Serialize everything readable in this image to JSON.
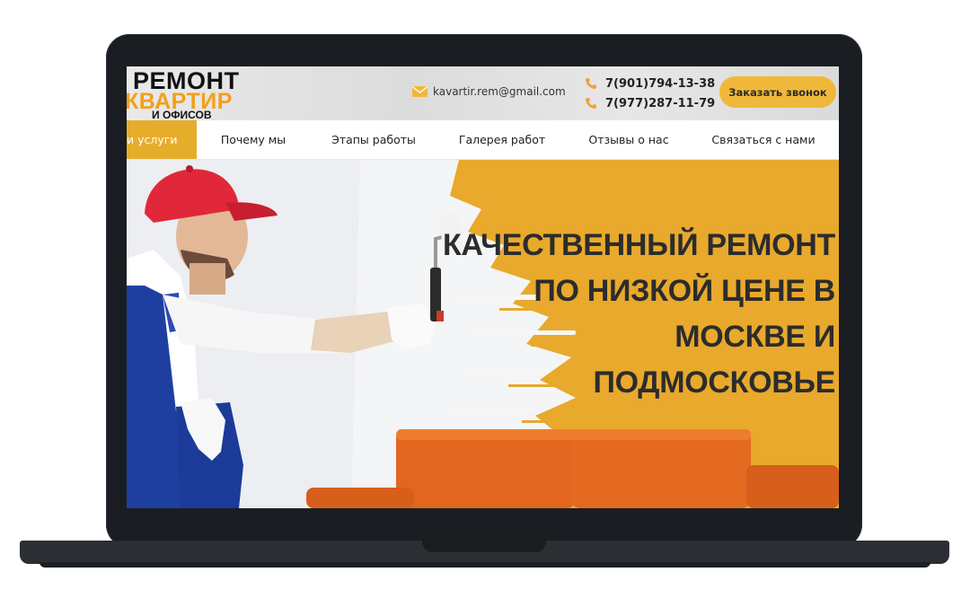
{
  "logo": {
    "line1": "РЕМОНТ",
    "line2": "КВАРТИР",
    "line3": "И ОФИСОВ"
  },
  "header": {
    "email": "kavartir.rem@gmail.com",
    "phones": [
      "7(901)794-13-38",
      "7(977)287-11-79"
    ],
    "call_button": "Заказать звонок"
  },
  "nav": {
    "items": [
      {
        "label": "и услуги",
        "active": true
      },
      {
        "label": "Почему мы"
      },
      {
        "label": "Этапы работы"
      },
      {
        "label": "Галерея работ"
      },
      {
        "label": "Отзывы о нас"
      },
      {
        "label": "Связаться с нами"
      }
    ]
  },
  "hero": {
    "headline_lines": [
      "КАЧЕСТВЕННЫЙ РЕМОНТ",
      "ПО НИЗКОЙ ЦЕНЕ В",
      "МОСКВЕ И",
      "ПОДМОСКОВЬЕ"
    ]
  },
  "colors": {
    "accent": "#f0b83a",
    "nav_active": "#e6ad2b",
    "wall_yellow": "#e8a92c",
    "sofa_orange": "#e2661f",
    "cap_red": "#e0283a",
    "overalls_blue": "#1f3fa0",
    "laptop_frame": "#1a1e22"
  },
  "icons": [
    "mail-icon",
    "phone-icon",
    "paint-roller-icon"
  ]
}
